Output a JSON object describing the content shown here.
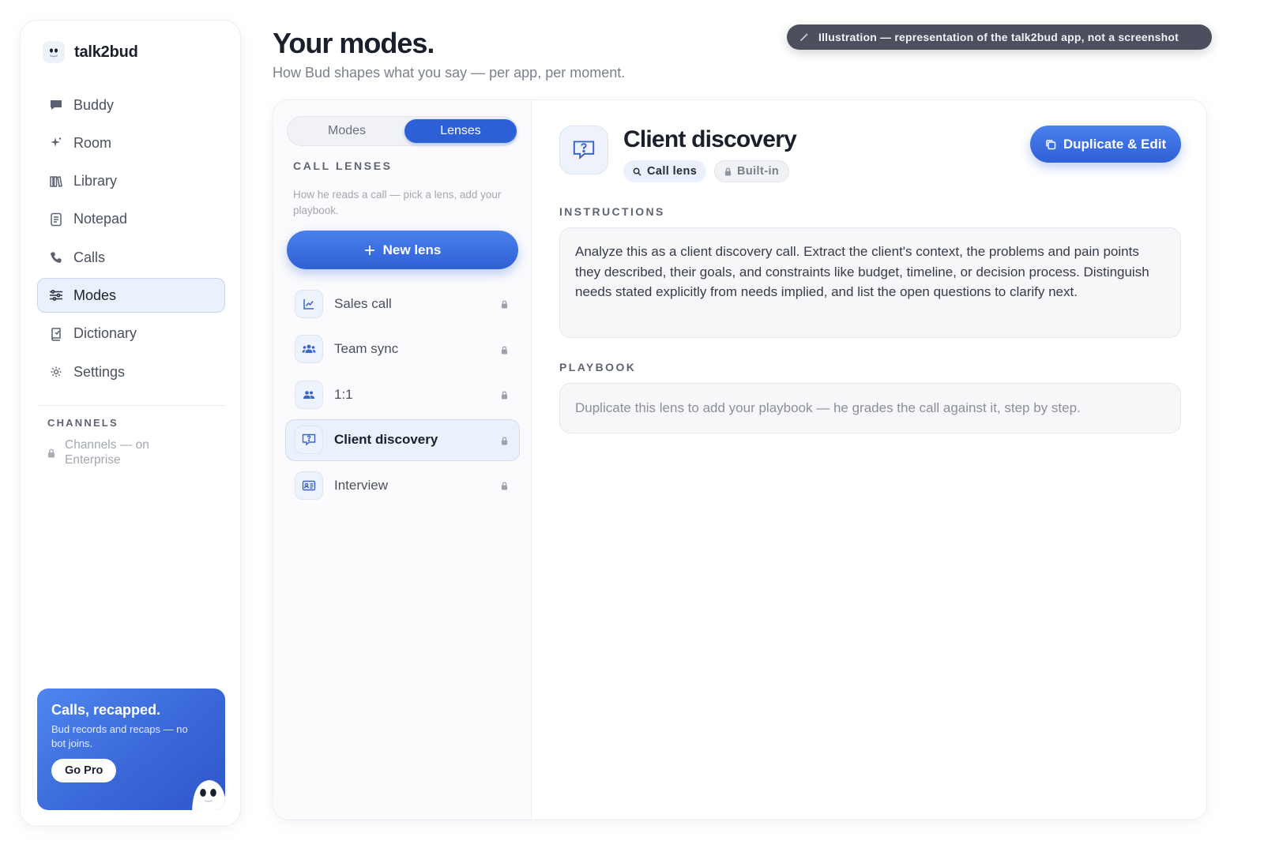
{
  "app": {
    "name": "talk2bud"
  },
  "illustration_note": "Illustration — representation of the talk2bud app, not a screenshot",
  "sidebar": {
    "items": [
      {
        "label": "Buddy",
        "icon": "chat-bubble-icon"
      },
      {
        "label": "Room",
        "icon": "sparkle-icon"
      },
      {
        "label": "Library",
        "icon": "books-icon"
      },
      {
        "label": "Notepad",
        "icon": "notepad-icon"
      },
      {
        "label": "Calls",
        "icon": "phone-icon"
      },
      {
        "label": "Modes",
        "icon": "sliders-icon",
        "active": true
      },
      {
        "label": "Dictionary",
        "icon": "dictionary-icon"
      },
      {
        "label": "Settings",
        "icon": "gear-icon"
      }
    ],
    "channels_title": "CHANNELS",
    "channels_note": "Channels — on Enterprise",
    "promo": {
      "title": "Calls, recapped.",
      "text": "Bud records and recaps — no bot joins.",
      "button": "Go Pro"
    }
  },
  "header": {
    "title": "Your modes.",
    "subtitle": "How Bud shapes what you say — per app, per moment."
  },
  "list_panel": {
    "tabs": [
      {
        "label": "Modes",
        "selected": false
      },
      {
        "label": "Lenses",
        "selected": true
      }
    ],
    "section_title": "CALL LENSES",
    "description": "How he reads a call — pick a lens, add your playbook.",
    "new_button": "New lens",
    "lenses": [
      {
        "label": "Sales call",
        "icon": "chart-icon",
        "locked": true
      },
      {
        "label": "Team sync",
        "icon": "team-icon",
        "locked": true
      },
      {
        "label": "1:1",
        "icon": "two-people-icon",
        "locked": true
      },
      {
        "label": "Client discovery",
        "icon": "question-bubble-icon",
        "locked": true,
        "active": true
      },
      {
        "label": "Interview",
        "icon": "id-card-icon",
        "locked": true
      }
    ]
  },
  "detail": {
    "title": "Client discovery",
    "chips": {
      "type": "Call lens",
      "origin": "Built-in"
    },
    "duplicate_button": "Duplicate & Edit",
    "instructions_label": "INSTRUCTIONS",
    "instructions_text": "Analyze this as a client discovery call. Extract the client's context, the problems and pain points they described, their goals, and constraints like budget, timeline, or decision process. Distinguish needs stated explicitly from needs implied, and list the open questions to clarify next.",
    "playbook_label": "PLAYBOOK",
    "playbook_text": "Duplicate this lens to add your playbook — he grades the call against it, step by step."
  },
  "colors": {
    "accent": "#2f60d6",
    "active_bg": "#eaf0fc",
    "pill_bg": "#4b4f5e"
  }
}
